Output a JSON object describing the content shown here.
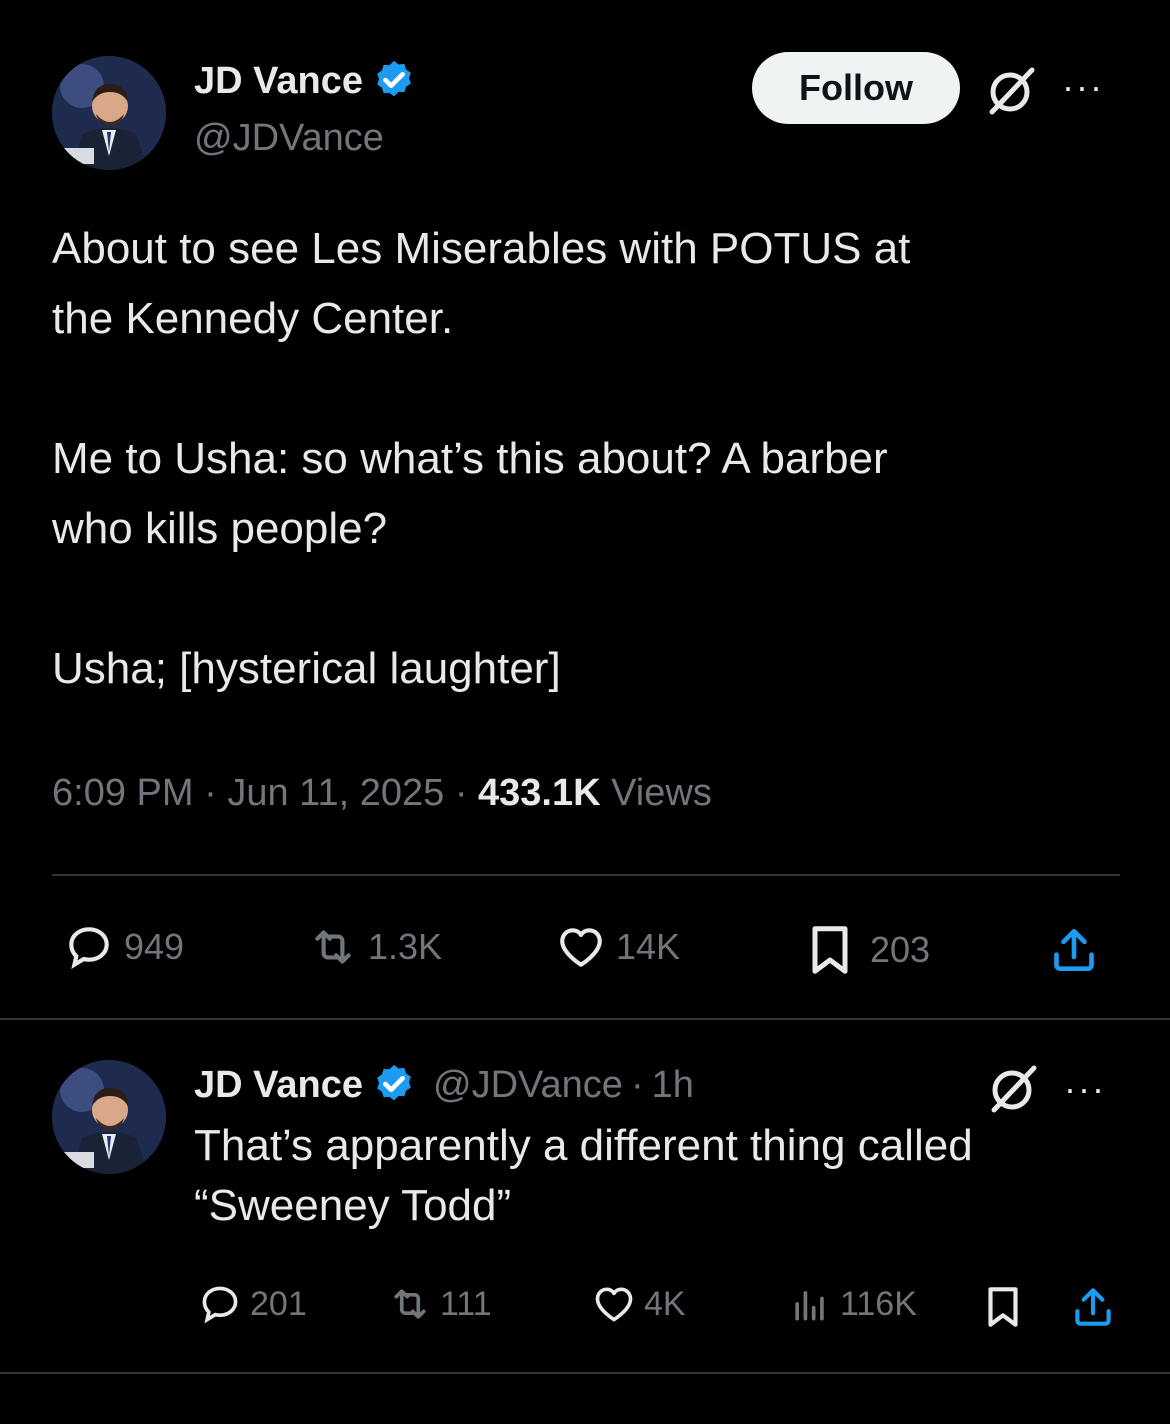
{
  "main_post": {
    "author_name": "JD Vance",
    "author_handle": "@JDVance",
    "follow_label": "Follow",
    "more_label": "···",
    "text": "About to see Les Miserables with POTUS at\nthe Kennedy Center.\n\nMe to Usha: so what’s this about? A barber\nwho kills people?\n\nUsha; [hysterical laughter]",
    "time": "6:09 PM",
    "date": "Jun 11, 2025",
    "sep": "·",
    "views_count": "433.1K",
    "views_label": "Views",
    "actions": {
      "replies": "949",
      "reposts": "1.3K",
      "likes": "14K",
      "bookmarks": "203"
    }
  },
  "reply_post": {
    "author_name": "JD Vance",
    "author_handle": "@JDVance",
    "sep": "·",
    "time_ago": "1h",
    "more_label": "···",
    "text": "That’s apparently a different thing called\n“Sweeney Todd”",
    "actions": {
      "replies": "201",
      "reposts": "111",
      "likes": "4K",
      "views": "116K"
    }
  },
  "colors": {
    "background": "#000000",
    "text": "#e7e9ea",
    "muted": "#71767b",
    "verified": "#1d9bf0",
    "divider": "#2f3336"
  },
  "icons": [
    "verified-badge-icon",
    "grok-icon",
    "more-icon",
    "reply-icon",
    "repost-icon",
    "like-icon",
    "bookmark-icon",
    "share-icon",
    "views-icon"
  ]
}
